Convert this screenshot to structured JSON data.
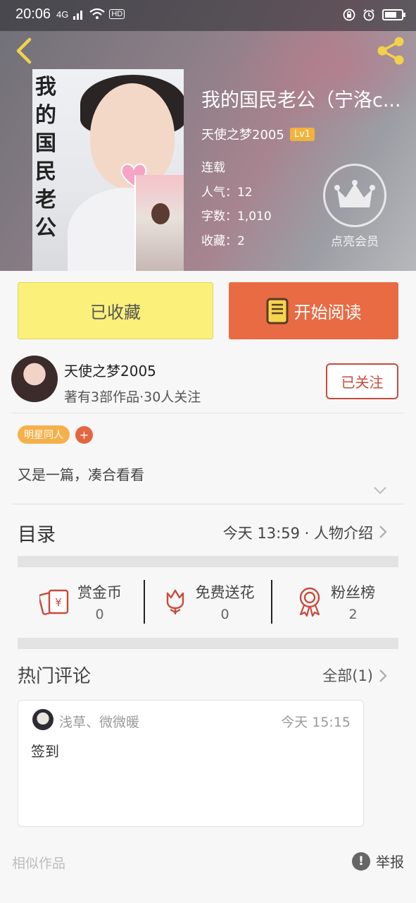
{
  "status_bar": {
    "time": "20:06",
    "network": "4G",
    "hd": "HD"
  },
  "book": {
    "title": "我的国民老公（宁洛c...",
    "cover_title": "我的国民老公",
    "author": "天使之梦2005",
    "level": "Lv1",
    "status": "连载",
    "popularity": "人气：12",
    "word_count": "字数：1,010",
    "favorites": "收藏：2",
    "vip_label": "点亮会员"
  },
  "actions": {
    "favorited_label": "已收藏",
    "read_label": "开始阅读"
  },
  "author_card": {
    "name": "天使之梦2005",
    "summary": "著有3部作品·30人关注",
    "follow_label": "已关注"
  },
  "tags": [
    "明星同人"
  ],
  "tag_add": "+",
  "description": "又是一篇，凑合看看",
  "toc": {
    "label": "目录",
    "latest": "今天 13:59 · 人物介绍"
  },
  "stats": [
    {
      "label": "赏金币",
      "value": "0",
      "icon": "red-envelope-icon"
    },
    {
      "label": "免费送花",
      "value": "0",
      "icon": "flower-icon"
    },
    {
      "label": "粉丝榜",
      "value": "2",
      "icon": "medal-icon"
    }
  ],
  "hot_comments": {
    "label": "热门评论",
    "all_label": "全部(1)"
  },
  "comments": [
    {
      "user": "浅草、微微暖",
      "time": "今天 15:15",
      "text": "签到"
    }
  ],
  "footer": {
    "similar_label": "相似作品",
    "report_label": "举报"
  },
  "colors": {
    "accent_orange": "#e86b43",
    "fav_yellow": "#fbf07a",
    "follow_red": "#c94a3b",
    "tag_orange": "#f6b04a"
  }
}
